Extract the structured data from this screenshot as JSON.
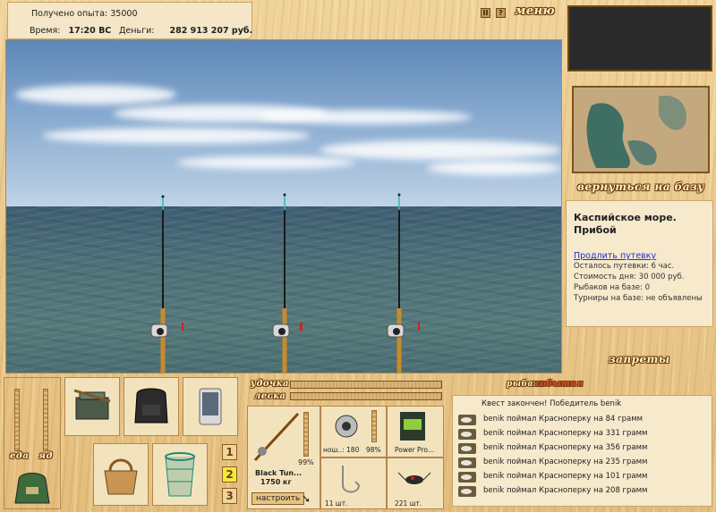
{
  "header": {
    "xp_label": "Получено опыта:",
    "xp_value": "35000",
    "time_label": "Время:",
    "time_value": "17:20 ВС",
    "money_label": "Деньги:",
    "money_value": "282 913 207 руб.",
    "menu_label": "меню",
    "pause_glyph": "II",
    "help_glyph": "?"
  },
  "right_panel": {
    "return_label": "вернуться на базу",
    "location_title": "Каспийское море. Прибой",
    "extend_link": "Продлить путевку",
    "remaining": "Осталось путевки: 6 час.",
    "day_cost": "Стоимость дня: 30 000 руб.",
    "anglers": "Рыбаков на базе: 0",
    "tournaments": "Турниры на базе: не объявлены",
    "bans_label": "запреты"
  },
  "bottom_left": {
    "food_label": "еда",
    "bait_label": "яд"
  },
  "tackle": {
    "rod_label": "удочка",
    "line_label": "леска",
    "rod_name": "Black Tun...",
    "rod_weight": "1750 кг",
    "rod_percent": "99%",
    "reel_name": "нош..: 180",
    "reel_percent": "98%",
    "lure_name": "Power Pro...",
    "hook_count": "11 шт.",
    "bait_count": "221 шт.",
    "setup_button": "настроить"
  },
  "slots": [
    "1",
    "2",
    "3"
  ],
  "events": {
    "tab_anglers": "рыбаки",
    "tab_events": "события",
    "quest_line": "Квест закончен! Победитель benik",
    "items": [
      "benik поймал Красноперку на 84 грамм",
      "benik поймал Красноперку на 331 грамм",
      "benik поймал Красноперку на 356 грамм",
      "benik поймал Красноперку на 235 грамм",
      "benik поймал Красноперку на 101 грамм",
      "benik поймал Красноперку на 208 грамм"
    ]
  },
  "colors": {
    "wood": "#e8c98e",
    "link": "#1a2fd6",
    "events_tab_active": "#c0220c",
    "sea": "#4d6f78"
  }
}
